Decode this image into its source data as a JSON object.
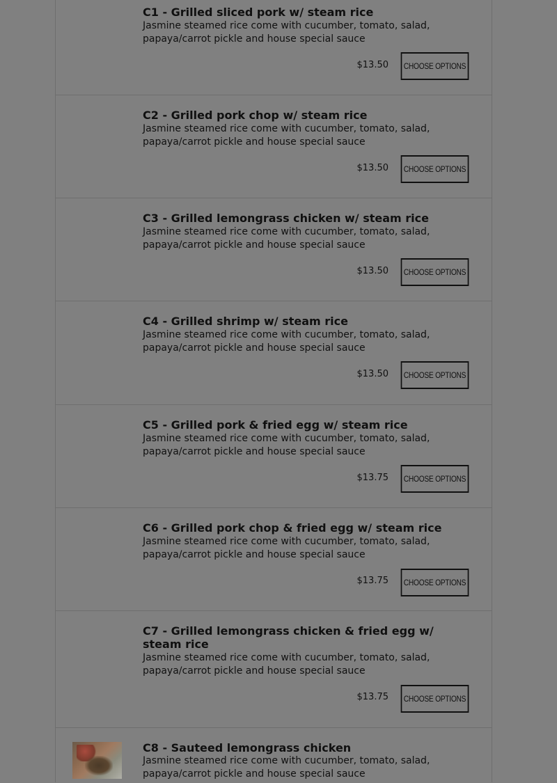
{
  "menu": {
    "button_label": "Choose Options",
    "items": [
      {
        "name": "C1 - Grilled sliced pork w/ steam rice",
        "description": "Jasmine steamed rice come with cucumber, tomato, salad, papaya/carrot pickle and house special sauce",
        "price": "$13.50"
      },
      {
        "name": "C2 - Grilled pork chop w/ steam rice",
        "description": "Jasmine steamed rice come with cucumber, tomato, salad, papaya/carrot pickle and house special sauce",
        "price": "$13.50"
      },
      {
        "name": "C3 - Grilled lemongrass chicken w/ steam rice",
        "description": "Jasmine steamed rice come with cucumber, tomato, salad, papaya/carrot pickle and house special sauce",
        "price": "$13.50"
      },
      {
        "name": "C4 - Grilled shrimp w/ steam rice",
        "description": "Jasmine steamed rice come with cucumber, tomato, salad, papaya/carrot pickle and house special sauce",
        "price": "$13.50"
      },
      {
        "name": "C5 - Grilled pork & fried egg w/ steam rice",
        "description": "Jasmine steamed rice come with cucumber, tomato, salad, papaya/carrot pickle and house special sauce",
        "price": "$13.75"
      },
      {
        "name": "C6 - Grilled pork chop & fried egg w/ steam rice",
        "description": "Jasmine steamed rice come with cucumber, tomato, salad, papaya/carrot pickle and house special sauce",
        "price": "$13.75"
      },
      {
        "name": "C7 - Grilled lemongrass chicken & fried egg w/ steam rice",
        "description": "Jasmine steamed rice come with cucumber, tomato, salad, papaya/carrot pickle and house special sauce",
        "price": "$13.75"
      },
      {
        "name": "C8 - Sauteed lemongrass chicken",
        "description": "Jasmine steamed rice come with cucumber, tomato, salad, papaya/carrot pickle and house special sauce",
        "price": ""
      }
    ]
  }
}
